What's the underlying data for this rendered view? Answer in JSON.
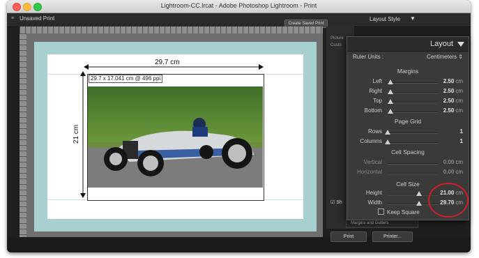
{
  "window": {
    "title": "Lightroom-CC.lrcat - Adobe Photoshop Lightroom - Print"
  },
  "toolbar": {
    "collection": "Unsaved Print",
    "create_saved_print": "Create Saved Print",
    "layout_style": "Layout Style"
  },
  "canvas": {
    "width_label": "29.7 cm",
    "height_label": "21 cm",
    "cell_info": "29.7 x 17.041 cm @ 496 ppi"
  },
  "right_strip": {
    "labels": [
      "Picture",
      "Custo"
    ]
  },
  "panel": {
    "title": "Layout",
    "ruler_units_label": "Ruler Units :",
    "ruler_units_value": "Centimeters",
    "sections": {
      "margins": "Margins",
      "page_grid": "Page Grid",
      "cell_spacing": "Cell Spacing",
      "cell_size": "Cell Size"
    },
    "margins": [
      {
        "label": "Left",
        "value": "2.50",
        "unit": "cm",
        "pos": 0.05
      },
      {
        "label": "Right",
        "value": "2.50",
        "unit": "cm",
        "pos": 0.05
      },
      {
        "label": "Top",
        "value": "2.50",
        "unit": "cm",
        "pos": 0.05
      },
      {
        "label": "Bottom",
        "value": "2.50",
        "unit": "cm",
        "pos": 0.05
      }
    ],
    "page_grid": [
      {
        "label": "Rows",
        "value": "1",
        "pos": 0.0
      },
      {
        "label": "Columns",
        "value": "1",
        "pos": 0.0
      }
    ],
    "cell_spacing": [
      {
        "label": "Vertical",
        "value": "0.00",
        "unit": "cm"
      },
      {
        "label": "Horizontal",
        "value": "0.00",
        "unit": "cm"
      }
    ],
    "cell_size": [
      {
        "label": "Height",
        "value": "21.00",
        "unit": "cm",
        "pos": 0.62
      },
      {
        "label": "Width",
        "value": "29.70",
        "unit": "cm",
        "pos": 0.62
      }
    ],
    "keep_square": "Keep Square"
  },
  "bottom": {
    "margins_and_gutters": "Margins and Gutters",
    "print": "Print",
    "printer": "Printer...",
    "show_guides": "Sh"
  }
}
